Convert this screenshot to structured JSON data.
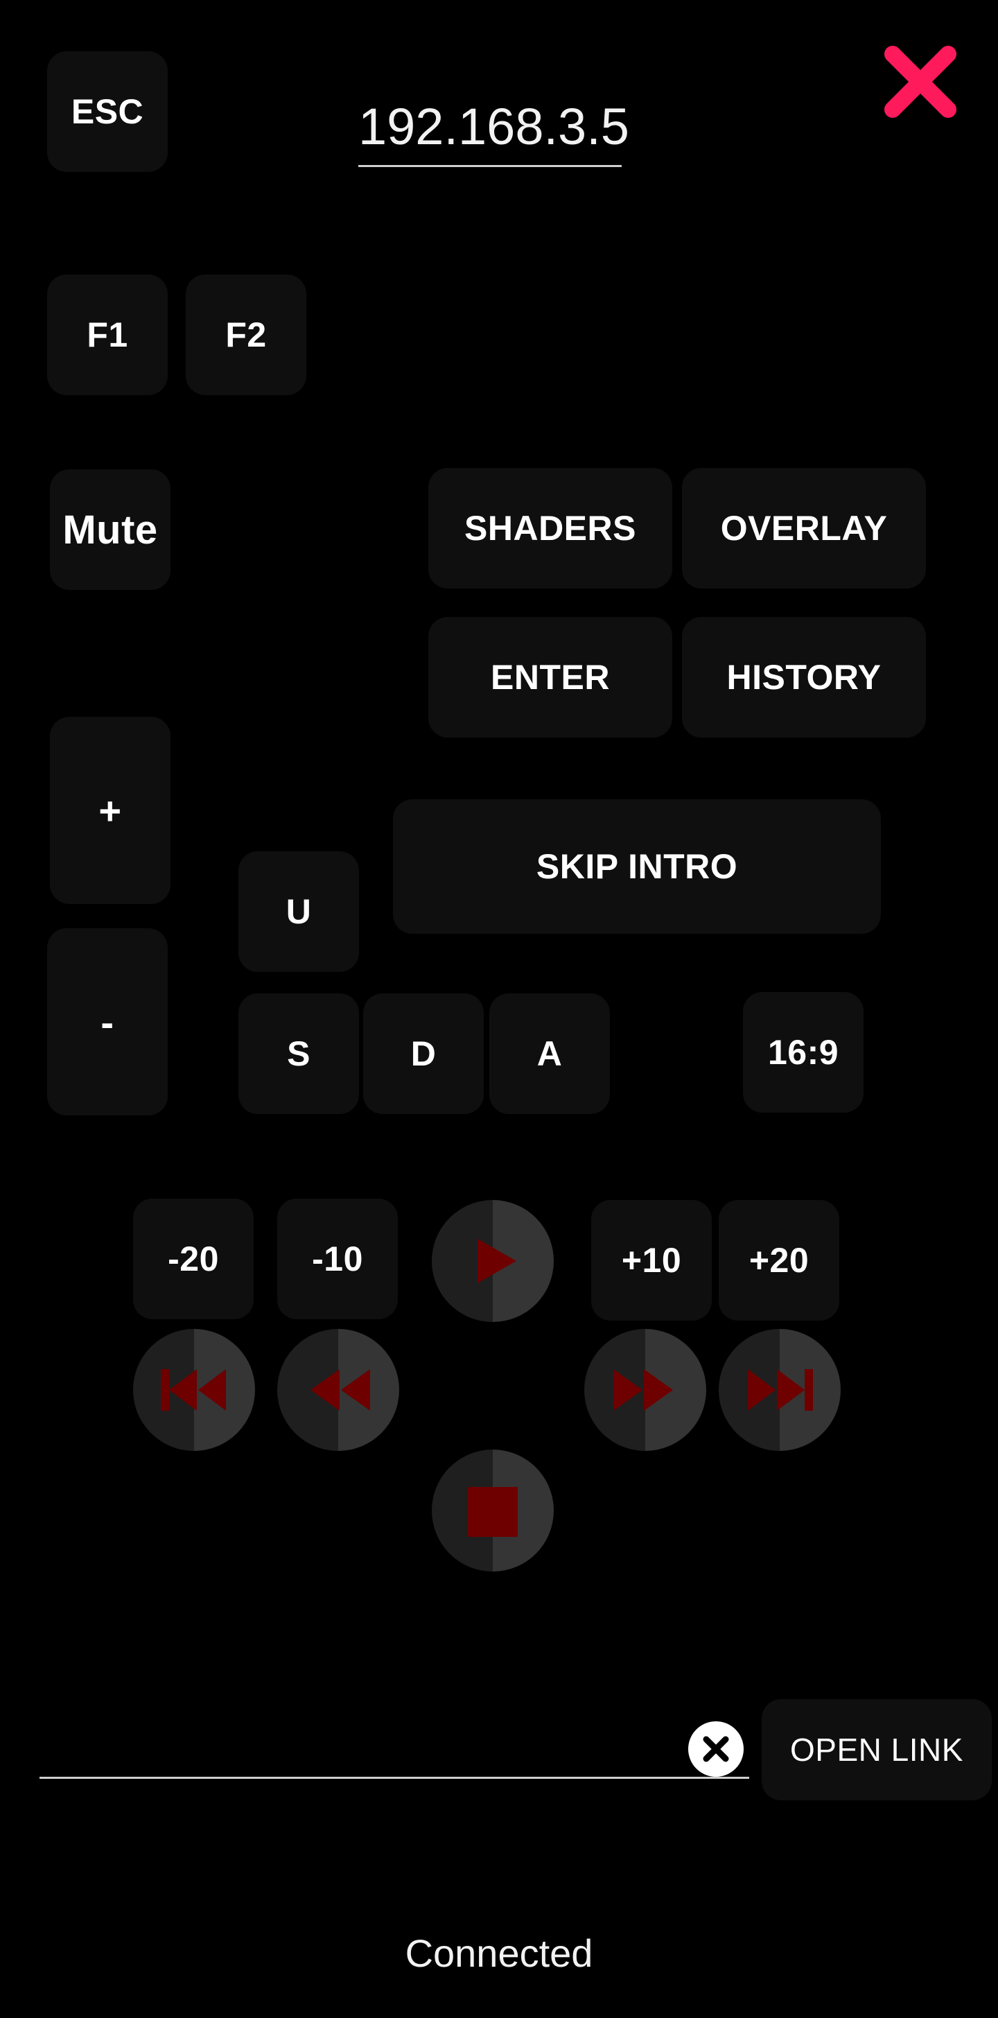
{
  "header": {
    "esc_label": "ESC",
    "ip_address": "192.168.3.5"
  },
  "close_icon": "close-icon",
  "function_keys": {
    "f1": "F1",
    "f2": "F2"
  },
  "mute_label": "Mute",
  "actions": {
    "shaders": "SHADERS",
    "overlay": "OVERLAY",
    "enter": "ENTER",
    "history": "HISTORY",
    "skip_intro": "SKIP INTRO",
    "aspect": "16:9"
  },
  "volume": {
    "up": "+",
    "down": "-"
  },
  "keys": {
    "u": "U",
    "s": "S",
    "d": "D",
    "a": "A"
  },
  "seek": {
    "back20": "-20",
    "back10": "-10",
    "fwd10": "+10",
    "fwd20": "+20"
  },
  "media_icons": {
    "play": "play-icon",
    "skip_back": "skip-back-icon",
    "rewind": "rewind-icon",
    "fast_forward": "fast-forward-icon",
    "skip_forward": "skip-forward-icon",
    "stop": "stop-icon"
  },
  "url_input": {
    "value": "",
    "placeholder": ""
  },
  "open_link_label": "OPEN LINK",
  "status": "Connected",
  "colors": {
    "accent": "#ff1a5c",
    "media_red": "#6e0000",
    "button_bg": "#0f0f0f"
  }
}
